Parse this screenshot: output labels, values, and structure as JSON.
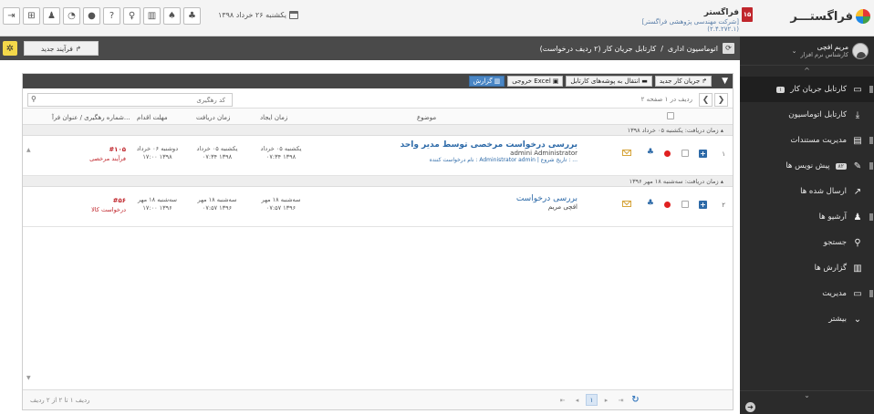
{
  "topbar": {
    "date": "یکشنبه ۲۶ خرداد ۱۳۹۸",
    "company_title": "فراگستر",
    "company_sub": "[شرکت مهندسی پژوهشی فراگستر] (۲.۴.۲۷۲.۱)",
    "badge": "۱۵",
    "logo_text": "فراگستـــر",
    "icons": [
      "exit-icon",
      "org-chart-icon",
      "user-icon",
      "chat-icon",
      "message-icon",
      "help-icon",
      "microphone-icon",
      "chart-icon",
      "bell-icon",
      "hierarchy-icon"
    ]
  },
  "sidebar": {
    "user_name": "مریم افچی",
    "user_role": "کارشناس نرم افزار",
    "items": [
      {
        "label": "کارتابل جریان کار",
        "badge": "۱",
        "icon": "inbox-icon"
      },
      {
        "label": "کارتابل اتوماسیون",
        "icon": "download-icon"
      },
      {
        "label": "مدیریت مستندات",
        "icon": "document-icon"
      },
      {
        "label": "پیش نویس ها",
        "badge": "۸۲",
        "icon": "edit-icon"
      },
      {
        "label": "ارسال شده ها",
        "icon": "send-icon"
      },
      {
        "label": "آرشیو ها",
        "icon": "archive-icon"
      },
      {
        "label": "جستجو",
        "icon": "search-icon"
      },
      {
        "label": "گزارش ها",
        "icon": "report-icon"
      },
      {
        "label": "مدیریت",
        "icon": "admin-icon"
      },
      {
        "label": "بیشتر",
        "icon": "chevron-down-icon"
      }
    ]
  },
  "subbar": {
    "new_process": "فرآیند جدید",
    "breadcrumb_root": "اتوماسیون اداری",
    "breadcrumb_sep": "/",
    "breadcrumb_current": "کارتابل جریان کار (۲ ردیف درخواست)"
  },
  "toolbar": {
    "new_workflow": "جریان کار جدید",
    "move_folder": "انتقال به پوشه‌های کارتابل",
    "excel": "خروجی Excel",
    "report": "گزارش"
  },
  "pager": {
    "info": "۲ ردیف در ۱ صفحه",
    "search_placeholder": "کد رهگیری"
  },
  "columns": {
    "subject": "موضوع",
    "created": "زمان ایجاد",
    "received": "زمان دریافت",
    "deadline": "مهلت اقدام",
    "tracking": "شماره رهگیری / عنوان فرآ..."
  },
  "groups": [
    {
      "header": "زمان دریافت: یکشنبه ۰۵ خرداد ۱۳۹۸",
      "row": {
        "num": "۱",
        "title": "بررسی درخواست مرخصی توسط مدیر واحد",
        "user": "admini Administrator",
        "meta": "نام درخواست کننده : Administrator admin | تاریخ شروع : ...",
        "created_day": "یکشنبه ۰۵ خرداد",
        "created_time": "۰۷:۳۴ ۱۳۹۸",
        "received_day": "یکشنبه ۰۵ خرداد",
        "received_time": "۰۷:۳۴ ۱۳۹۸",
        "deadline_day": "دوشنبه ۰۶ خرداد",
        "deadline_time": "۱۷:۰۰ ۱۳۹۸",
        "tracking_num": "#۱۰۵",
        "tracking_name": "فرآیند مرخصی"
      }
    },
    {
      "header": "زمان دریافت: سه‌شنبه ۱۸ مهر ۱۳۹۶",
      "row": {
        "num": "۲",
        "title": "بررسی درخواست",
        "user": "افچی مریم",
        "meta": "",
        "created_day": "سه‌شنبه ۱۸ مهر",
        "created_time": "۰۷:۵۷ ۱۳۹۶",
        "received_day": "سه‌شنبه ۱۸ مهر",
        "received_time": "۰۷:۵۷ ۱۳۹۶",
        "deadline_day": "سه‌شنبه ۱۸ مهر",
        "deadline_time": "۱۷:۰۰ ۱۳۹۶",
        "tracking_num": "#۵۶",
        "tracking_name": "درخواست کالا"
      }
    }
  ],
  "footer": {
    "info": "ردیف ۱ تا ۲ از ۲ ردیف",
    "page": "۱"
  }
}
